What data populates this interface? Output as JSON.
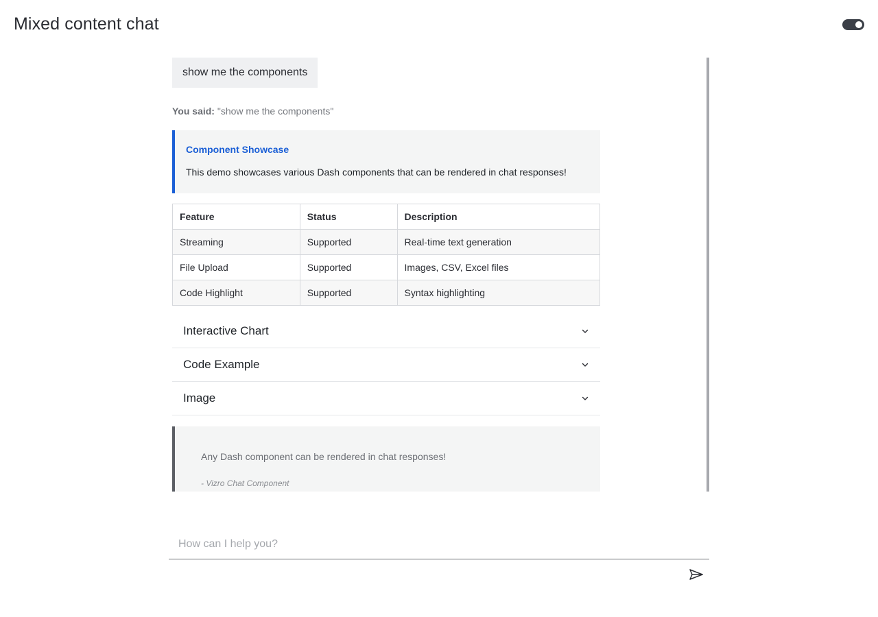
{
  "header": {
    "title": "Mixed content chat",
    "theme_toggle": {
      "state": "on"
    }
  },
  "chat": {
    "user_message": "show me the components",
    "echo": {
      "prefix": "You said:",
      "text": "\"show me the components\""
    },
    "callout": {
      "title": "Component Showcase",
      "body": "This demo showcases various Dash components that can be rendered in chat responses!",
      "accent_color": "#1b5fd6"
    },
    "table": {
      "columns": [
        "Feature",
        "Status",
        "Description"
      ],
      "rows": [
        [
          "Streaming",
          "Supported",
          "Real-time text generation"
        ],
        [
          "File Upload",
          "Supported",
          "Images, CSV, Excel files"
        ],
        [
          "Code Highlight",
          "Supported",
          "Syntax highlighting"
        ]
      ]
    },
    "accordion": [
      {
        "label": "Interactive Chart",
        "icon": "chevron-down-icon"
      },
      {
        "label": "Code Example",
        "icon": "chevron-down-icon"
      },
      {
        "label": "Image",
        "icon": "chevron-down-icon"
      }
    ],
    "quote": {
      "text": "Any Dash component can be rendered in chat responses!",
      "cite": "- Vizro Chat Component"
    }
  },
  "input": {
    "placeholder": "How can I help you?",
    "value": "",
    "send_icon": "send-icon"
  }
}
